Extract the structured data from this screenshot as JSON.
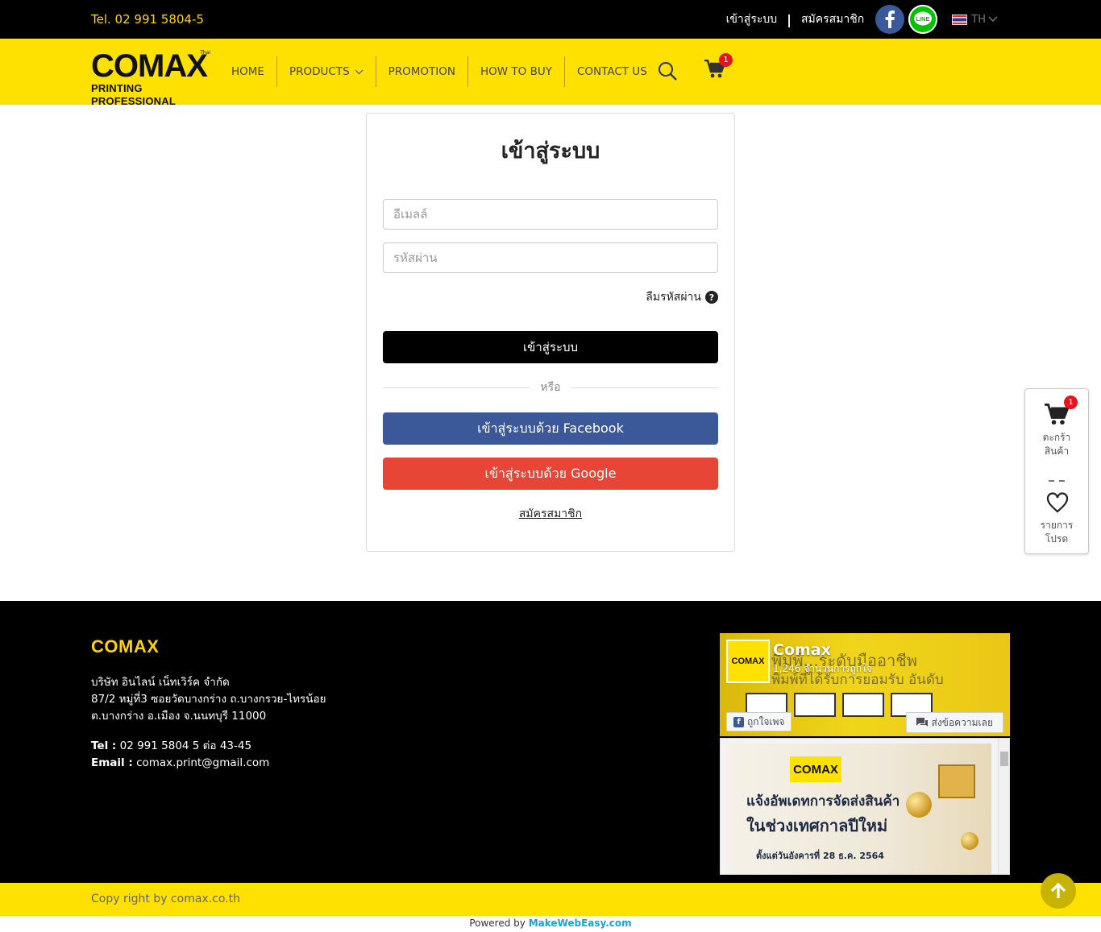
{
  "topbar": {
    "tel": "Tel. 02 991 5804-5",
    "login": "เข้าสู่ระบบ",
    "separator": "|",
    "register": "สมัครสมาชิก",
    "language": "TH",
    "line_label": "LINE"
  },
  "nav": {
    "logo_main": "COMAX",
    "logo_sub": "PRINTING PROFESSIONAL",
    "logo_tm": "Thai",
    "items": [
      {
        "label": "HOME"
      },
      {
        "label": "PRODUCTS"
      },
      {
        "label": "PROMOTION"
      },
      {
        "label": "HOW TO BUY"
      },
      {
        "label": "CONTACT US"
      }
    ],
    "cart_count": "1",
    "accent": "#ffe100"
  },
  "login_form": {
    "title": "เข้าสู่ระบบ",
    "email_placeholder": "อีเมลล์",
    "password_placeholder": "รหัสผ่าน",
    "forgot": "ลืมรหัสผ่าน",
    "submit": "เข้าสู่ระบบ",
    "or": "หรือ",
    "facebook": "เข้าสู่ระบบด้วย Facebook",
    "google": "เข้าสู่ระบบด้วย Google",
    "register": "สมัครสมาชิก",
    "facebook_color": "#3b5998",
    "google_color": "#e74536"
  },
  "side_widget": {
    "cart_count": "1",
    "cart_label_1": "ตะกร้า",
    "cart_label_2": "สินค้า",
    "wish_label_1": "รายการ",
    "wish_label_2": "โปรด"
  },
  "footer": {
    "brand": "COMAX",
    "company": "บริษัท อินไลน์ เน็ทเวิร์ค จำกัด",
    "address_1": "87/2 หมู่ที่3 ซอยวัดบางกร่าง ถ.บางกรวย-ไทรน้อย",
    "address_2": "ต.บางกร่าง อ.เมือง จ.นนทบุรี 11000",
    "tel_label": "Tel :",
    "tel": "02 991 5804 5 ต่อ 43-45",
    "email_label": "Email :",
    "email": "comax.print@gmail.com",
    "fb_page": {
      "name": "Comax",
      "likes": "1,246 จำนวนการถูกใจ",
      "cover_text_1": "พิมพ์...ระดับมืออาชีพ",
      "cover_text_2": "พิมพ์ที่ได้รับการยอมรับ อันดับ",
      "avatar_text": "COMAX",
      "like_button": "ถูกใจเพจ",
      "message_button": "ส่งข้อความเลย",
      "post_logo": "COMAX",
      "post_line_1": "แจ้งอัพเดทการจัดส่งสินค้า",
      "post_line_2": "ในช่วงเทศกาลปีใหม่",
      "post_line_3": "ตั้งแต่วันอังคารที่ 28 ธ.ค. 2564"
    }
  },
  "bottom": {
    "copyright": "Copy right by comax.co.th",
    "powered_prefix": "Powered by",
    "powered_brand": "MakeWebEasy.com"
  }
}
